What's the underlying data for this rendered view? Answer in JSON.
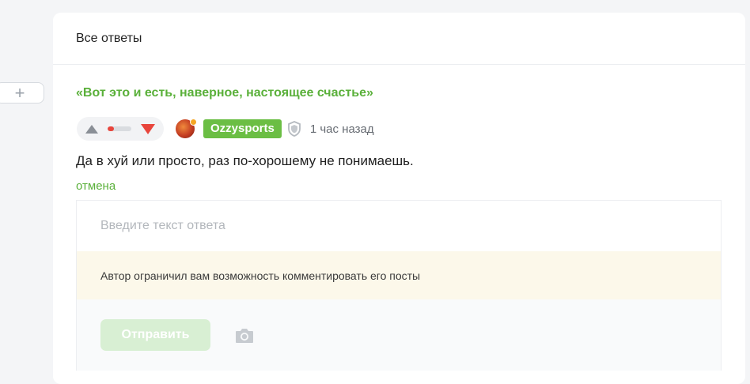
{
  "header": {
    "title": "Все ответы"
  },
  "thread": {
    "expand_label": "+"
  },
  "comment": {
    "quote": "«Вот это и есть, наверное, настоящее счастье»",
    "rating_fraction": 0.25,
    "author": "Ozzysports",
    "time": "1 час назад",
    "text": "Да в хуй или просто, раз по-хорошему не понимаешь.",
    "cancel_label": "отмена"
  },
  "reply": {
    "placeholder": "Введите текст ответа",
    "restriction_notice": "Автор ограничил вам возможность комментировать его посты",
    "send_label": "Отправить"
  },
  "colors": {
    "accent_green": "#5ab03a",
    "username_bg": "#6bbe44",
    "downvote": "#e8453c",
    "notice_bg": "#fcf8ea"
  },
  "icons": [
    "plus-icon",
    "upvote-icon",
    "downvote-icon",
    "shield-icon",
    "camera-icon"
  ]
}
